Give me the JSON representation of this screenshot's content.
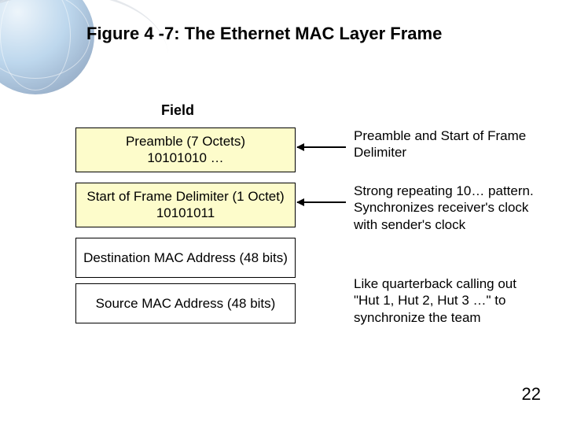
{
  "title": "Figure 4 -7: The Ethernet MAC Layer Frame",
  "field_header": "Field",
  "cells": {
    "preamble": {
      "line1": "Preamble (7 Octets)",
      "line2": "10101010 …"
    },
    "sfd": {
      "line1": "Start of Frame Delimiter (1 Octet)",
      "line2": "10101011"
    },
    "dst": {
      "line1": "Destination MAC Address (48 bits)"
    },
    "src": {
      "line1": "Source MAC Address (48 bits)"
    }
  },
  "annotations": {
    "a1": "Preamble and Start of Frame Delimiter",
    "a2": "Strong repeating 10… pattern. Synchronizes receiver's clock with sender's clock",
    "a3": "Like quarterback calling out \"Hut 1, Hut 2, Hut 3 …\" to synchronize the team"
  },
  "page_number": "22"
}
